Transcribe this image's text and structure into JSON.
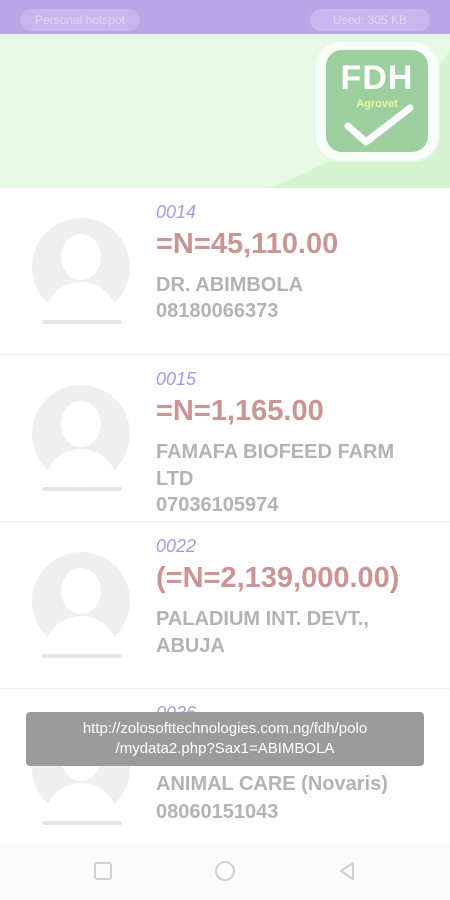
{
  "statusbar": {
    "left_pill": "Personal hotspot",
    "right_pill": "Used: 305 KB"
  },
  "logo": {
    "title": "FDH",
    "subtitle": "Agrovet"
  },
  "colors": {
    "status_bar": "#b9a6e6",
    "hero_bg": "#d4f5cf",
    "code": "#a39be6",
    "amount": "#c99595",
    "text_muted": "#b3b3b3"
  },
  "items": [
    {
      "code": "0014",
      "amount": "=N=45,110.00",
      "name": "DR. ABIMBOLA",
      "phone": "08180066373"
    },
    {
      "code": "0015",
      "amount": "=N=1,165.00",
      "name": "FAMAFA BIOFEED FARM LTD",
      "phone": "07036105974"
    },
    {
      "code": "0022",
      "amount": "(=N=2,139,000.00)",
      "name": "PALADIUM INT. DEVT., ABUJA",
      "phone": ""
    },
    {
      "code": "0036",
      "amount": "",
      "name": "ANIMAL CARE (Novaris)",
      "phone": "08060151043"
    }
  ],
  "toast": {
    "line1": "http://zolosofttechnologies.com.ng/fdh/polo",
    "line2": "/mydata2.php?Sax1=ABIMBOLA"
  },
  "navbar": {
    "icons": [
      "square-icon",
      "circle-icon",
      "back-triangle-icon"
    ]
  }
}
